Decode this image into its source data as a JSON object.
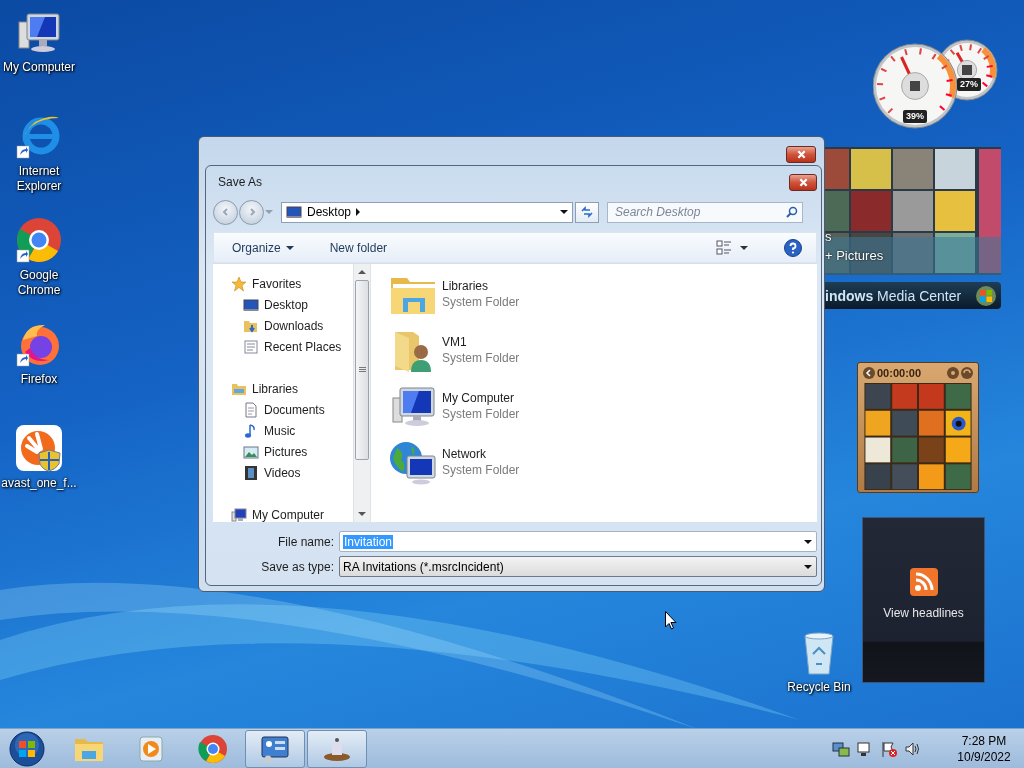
{
  "desktop_icons": [
    {
      "kind": "computer",
      "label": "My Computer",
      "shortcut": false
    },
    {
      "kind": "ie",
      "label": "Internet Explorer",
      "shortcut": true
    },
    {
      "kind": "chrome",
      "label": "Google Chrome",
      "shortcut": true
    },
    {
      "kind": "firefox",
      "label": "Firefox",
      "shortcut": true
    },
    {
      "kind": "avast",
      "label": "avast_one_f...",
      "shortcut": false
    }
  ],
  "recycle_bin": {
    "label": "Recycle Bin"
  },
  "cpu_meter": {
    "cpu_reading": "39%",
    "memory_reading": "27%"
  },
  "media_center": {
    "lines": [
      "s",
      "+ Pictures"
    ],
    "title": "**indows** Media Center"
  },
  "puzzle": {
    "timer": "00:00:00"
  },
  "headlines": {
    "link": "View headlines"
  },
  "dialog": {
    "title": "Save As",
    "address": "Desktop",
    "search_placeholder": "Search Desktop",
    "toolbar": [
      {
        "label": "Organize",
        "menu": true
      },
      {
        "label": "New folder",
        "menu": false
      }
    ],
    "nav_tree": [
      {
        "label": "Favorites",
        "kind": "star",
        "children": [
          {
            "label": "Desktop",
            "kind": "desktop"
          },
          {
            "label": "Downloads",
            "kind": "downloads"
          },
          {
            "label": "Recent Places",
            "kind": "recent"
          }
        ]
      },
      {
        "label": "Libraries",
        "kind": "libraries",
        "children": [
          {
            "label": "Documents",
            "kind": "documents"
          },
          {
            "label": "Music",
            "kind": "music"
          },
          {
            "label": "Pictures",
            "kind": "pictures"
          },
          {
            "label": "Videos",
            "kind": "videos"
          }
        ]
      },
      {
        "label": "My Computer",
        "kind": "computer"
      }
    ],
    "items": [
      {
        "name": "Libraries",
        "type": "System Folder",
        "kind": "libraries"
      },
      {
        "name": "VM1",
        "type": "System Folder",
        "kind": "user"
      },
      {
        "name": "My Computer",
        "type": "System Folder",
        "kind": "computer"
      },
      {
        "name": "Network",
        "type": "System Folder",
        "kind": "network"
      }
    ],
    "file_name": {
      "label": "File name:",
      "value": "Invitation",
      "text_selected": true
    },
    "save_type": {
      "label": "Save as type:",
      "value": "RA Invitations (*.msrcIncident)"
    }
  },
  "taskbar": {
    "pinned": [
      {
        "kind": "folder",
        "running": false
      },
      {
        "kind": "media",
        "running": false
      },
      {
        "kind": "chrome",
        "running": false
      },
      {
        "kind": "panel",
        "running": true
      },
      {
        "kind": "tool",
        "running": true
      }
    ],
    "clock": {
      "time": "7:28 PM",
      "date": "10/9/2022"
    }
  }
}
